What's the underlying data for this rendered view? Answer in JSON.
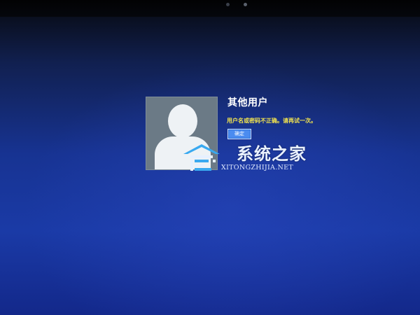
{
  "login": {
    "username": "其他用户",
    "error_message": "用户名或密码不正确。请再试一次。",
    "ok_label": "确定"
  },
  "watermark": {
    "title": "系统之家",
    "subtitle": "XITONGZHIJIA.NET"
  },
  "colors": {
    "background_top": "#0a1022",
    "background_main": "#1a3aa6",
    "error_text": "#f3e44e",
    "button_fill": "#4b8cf0",
    "tile": "#6b7a86"
  },
  "icons": {
    "avatar": "user-silhouette-icon",
    "watermark_logo": "house-logo-icon"
  }
}
